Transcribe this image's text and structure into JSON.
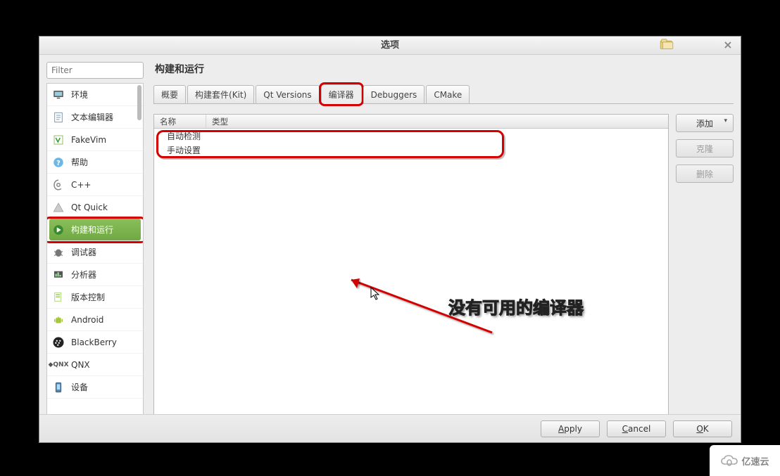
{
  "dialog": {
    "title": "选项"
  },
  "filter": {
    "placeholder": "Filter"
  },
  "sidebar": {
    "items": [
      {
        "label": "环境",
        "icon": "monitor"
      },
      {
        "label": "文本编辑器",
        "icon": "document"
      },
      {
        "label": "FakeVim",
        "icon": "fakevim"
      },
      {
        "label": "帮助",
        "icon": "help"
      },
      {
        "label": "C++",
        "icon": "cpp"
      },
      {
        "label": "Qt Quick",
        "icon": "qtquick"
      },
      {
        "label": "构建和运行",
        "icon": "buildrun",
        "selected": true
      },
      {
        "label": "调试器",
        "icon": "debugger"
      },
      {
        "label": "分析器",
        "icon": "analyzer"
      },
      {
        "label": "版本控制",
        "icon": "vcs"
      },
      {
        "label": "Android",
        "icon": "android"
      },
      {
        "label": "BlackBerry",
        "icon": "blackberry"
      },
      {
        "label": "QNX",
        "icon": "qnx"
      },
      {
        "label": "设备",
        "icon": "devices"
      }
    ]
  },
  "page": {
    "title": "构建和运行"
  },
  "tabs": [
    {
      "label": "概要"
    },
    {
      "label": "构建套件(Kit)"
    },
    {
      "label": "Qt Versions"
    },
    {
      "label": "编译器",
      "active": true
    },
    {
      "label": "Debuggers"
    },
    {
      "label": "CMake"
    }
  ],
  "table": {
    "headers": {
      "name": "名称",
      "type": "类型"
    },
    "rows": [
      "自动检测",
      "手动设置"
    ]
  },
  "sidebuttons": {
    "add": "添加",
    "clone": "克隆",
    "delete": "删除"
  },
  "annotation": {
    "text": "没有可用的编译器"
  },
  "footer": {
    "apply": "Apply",
    "cancel": "Cancel",
    "ok": "OK"
  },
  "watermark": {
    "text": "亿速云"
  }
}
